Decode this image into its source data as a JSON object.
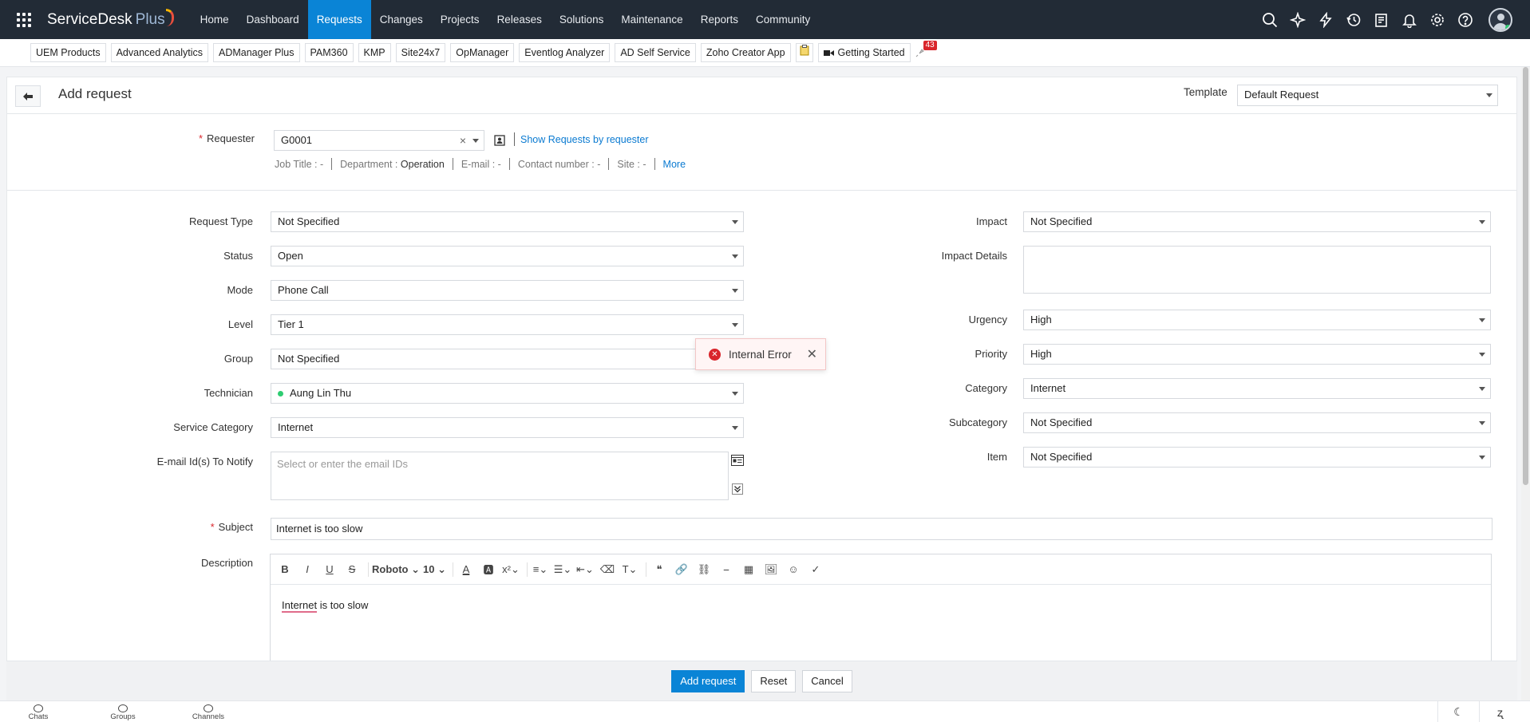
{
  "brand": {
    "name": "ServiceDesk",
    "suffix": "Plus"
  },
  "nav": [
    "Home",
    "Dashboard",
    "Requests",
    "Changes",
    "Projects",
    "Releases",
    "Solutions",
    "Maintenance",
    "Reports",
    "Community"
  ],
  "nav_active": "Requests",
  "apps": [
    "UEM Products",
    "Advanced Analytics",
    "ADManager Plus",
    "PAM360",
    "KMP",
    "Site24x7",
    "OpManager",
    "Eventlog Analyzer",
    "AD Self Service",
    "Zoho Creator App"
  ],
  "getting_started": "Getting Started",
  "notif_badge": "43",
  "page": {
    "title": "Add request",
    "template_label": "Template",
    "template_value": "Default Request"
  },
  "requester": {
    "label": "Requester",
    "value": "G0001",
    "clear": "×",
    "show_link": "Show Requests by requester",
    "job_title_label": "Job Title :",
    "job_title": "-",
    "dept_label": "Department :",
    "dept": "Operation",
    "email_label": "E-mail :",
    "email": "-",
    "contact_label": "Contact number :",
    "contact": "-",
    "site_label": "Site :",
    "site": "-",
    "more": "More"
  },
  "left_fields": {
    "request_type": {
      "label": "Request Type",
      "value": "Not Specified"
    },
    "status": {
      "label": "Status",
      "value": "Open"
    },
    "mode": {
      "label": "Mode",
      "value": "Phone Call"
    },
    "level": {
      "label": "Level",
      "value": "Tier 1"
    },
    "group": {
      "label": "Group",
      "value": "Not Specified"
    },
    "technician": {
      "label": "Technician",
      "value": "Aung Lin Thu"
    },
    "service_category": {
      "label": "Service Category",
      "value": "Internet"
    },
    "notify": {
      "label": "E-mail Id(s) To Notify",
      "placeholder": "Select or enter the email IDs"
    }
  },
  "right_fields": {
    "impact": {
      "label": "Impact",
      "value": "Not Specified"
    },
    "impact_details": {
      "label": "Impact Details"
    },
    "urgency": {
      "label": "Urgency",
      "value": "High"
    },
    "priority": {
      "label": "Priority",
      "value": "High"
    },
    "category": {
      "label": "Category",
      "value": "Internet"
    },
    "subcategory": {
      "label": "Subcategory",
      "value": "Not Specified"
    },
    "item": {
      "label": "Item",
      "value": "Not Specified"
    }
  },
  "subject": {
    "label": "Subject",
    "value": "Internet is too slow"
  },
  "description": {
    "label": "Description",
    "font": "Roboto",
    "size": "10",
    "body_word1": "Internet",
    "body_rest": " is too slow"
  },
  "toast": {
    "message": "Internal Error"
  },
  "footer": {
    "add": "Add request",
    "reset": "Reset",
    "cancel": "Cancel"
  },
  "bottom": {
    "chats": "Chats",
    "groups": "Groups",
    "channels": "Channels"
  },
  "colors": {
    "nav_bg": "#222b36",
    "accent": "#0a84d6",
    "error": "#d9262c",
    "link": "#0a7ad1"
  }
}
